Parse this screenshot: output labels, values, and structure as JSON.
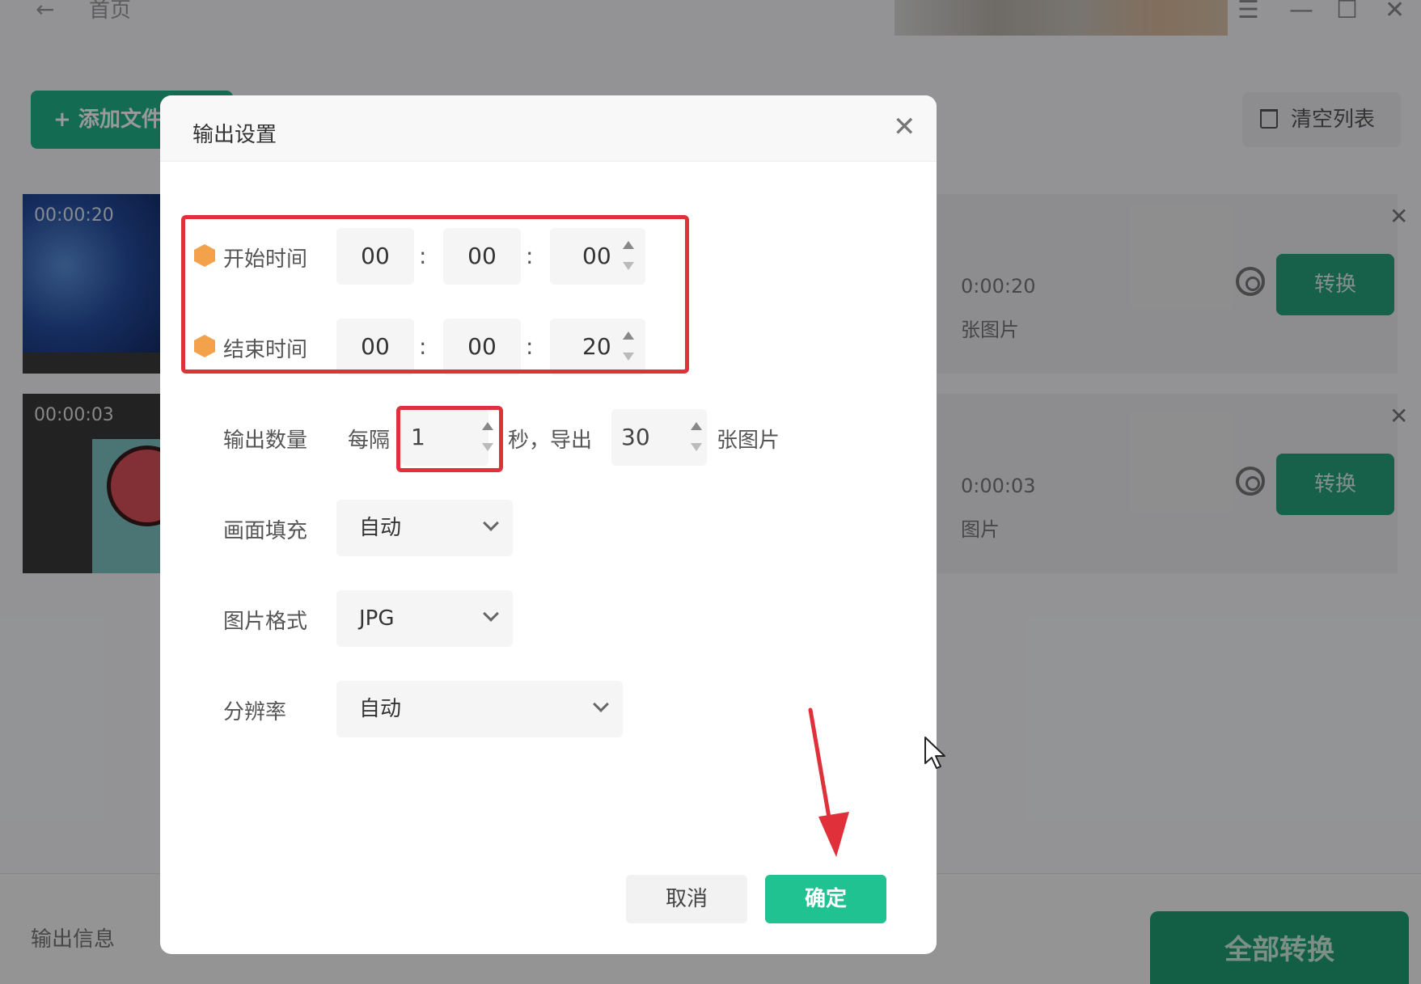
{
  "topbar": {
    "home_label": "首页"
  },
  "toolbar": {
    "add_file_label": "+ 添加文件",
    "clear_list_label": "清空列表"
  },
  "files": [
    {
      "thumb_time": "00:00:20",
      "duration": "0:00:20",
      "count_label": "张图片",
      "convert_label": "转换"
    },
    {
      "thumb_time": "00:00:03",
      "duration": "0:00:03",
      "count_label": "图片",
      "convert_label": "转换"
    }
  ],
  "bottom": {
    "output_info_label": "输出信息",
    "convert_all_label": "全部转换"
  },
  "dialog": {
    "title": "输出设置",
    "start_time": {
      "label": "开始时间",
      "hh": "00",
      "mm": "00",
      "ss": "00"
    },
    "end_time": {
      "label": "结束时间",
      "hh": "00",
      "mm": "00",
      "ss": "20"
    },
    "colon": ":",
    "output_count": {
      "label": "输出数量",
      "every_label": "每隔",
      "interval_value": "1",
      "seconds_label": "秒，导出",
      "export_value": "30",
      "images_label": "张图片"
    },
    "fill": {
      "label": "画面填充",
      "value": "自动"
    },
    "format": {
      "label": "图片格式",
      "value": "JPG"
    },
    "resolution": {
      "label": "分辨率",
      "value": "自动"
    },
    "cancel_label": "取消",
    "ok_label": "确定"
  },
  "colors": {
    "accent": "#21c291",
    "highlight": "#e0303a",
    "vip": "#f3a24b"
  },
  "icons": {
    "back": "back-arrow-icon",
    "menu": "menu-icon",
    "minimize": "minimize-icon",
    "maximize": "maximize-icon",
    "close": "close-icon",
    "trash": "trash-icon",
    "gear": "gear-icon",
    "vip": "vip-badge-icon",
    "chevron": "chevron-down-icon"
  }
}
